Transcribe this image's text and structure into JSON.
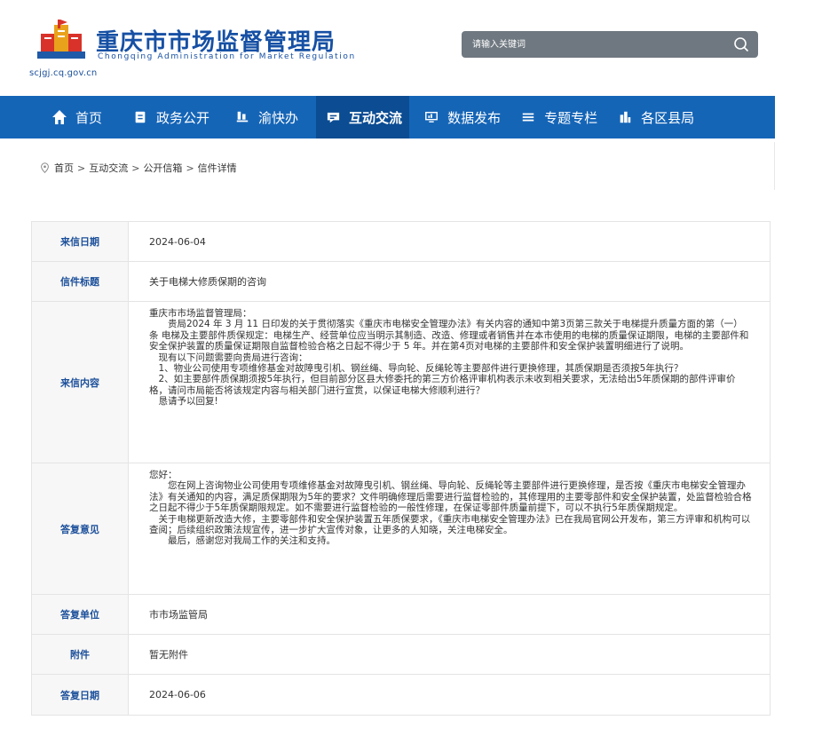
{
  "header": {
    "title": "重庆市市场监督管理局",
    "subtitle": "Chongqing  Administration for Market Regulation",
    "url": "scjgj.cq.gov.cn"
  },
  "search": {
    "placeholder": "请输入关键词",
    "icon": "search-icon"
  },
  "colors": {
    "nav_bg": "#1565b7",
    "nav_active": "#0b4c93",
    "brand": "#1650a4",
    "label_text": "#1b4f9a"
  },
  "nav": {
    "items": [
      {
        "label": "首页",
        "icon": "home-icon"
      },
      {
        "label": "政务公开",
        "icon": "document-icon"
      },
      {
        "label": "渝快办",
        "icon": "service-icon"
      },
      {
        "label": "互动交流",
        "icon": "chat-icon",
        "active": true
      },
      {
        "label": "数据发布",
        "icon": "monitor-icon"
      },
      {
        "label": "专题专栏",
        "icon": "list-icon"
      },
      {
        "label": "各区县局",
        "icon": "building-icon"
      }
    ]
  },
  "breadcrumb": {
    "items": [
      "首页",
      "互动交流",
      "公开信箱",
      "信件详情"
    ],
    "separator": ">"
  },
  "letter": {
    "date_label": "来信日期",
    "date": "2024-06-04",
    "title_label": "信件标题",
    "title": "关于电梯大修质保期的咨询",
    "content_label": "来信内容",
    "content": [
      "重庆市市场监督管理局：",
      "贵局2024 年 3 月 11 日印发的关于贯彻落实《重庆市电梯安全管理办法》有关内容的通知中第3页第三款关于电梯提升质量方面的第（一）条 电梯及主要部件质保规定：电梯生产、经营单位应当明示其制造、改造、修理或者销售并在本市使用的电梯的质量保证期限，电梯的主要部件和安全保护装置的质量保证期限自监督检验合格之日起不得少于 5 年。并在第4页对电梯的主要部件和安全保护装置明细进行了说明。",
      "现有以下问题需要向贵局进行咨询：",
      "1、物业公司使用专项维修基金对故障曳引机、钢丝绳、导向轮、反绳轮等主要部件进行更换修理，其质保期是否须按5年执行？",
      "2、如主要部件质保期须按5年执行，但目前部分区县大修委托的第三方价格评审机构表示未收到相关要求，无法给出5年质保期的部件评审价格，请问市局能否将该规定内容与相关部门进行宣贯，以保证电梯大修顺利进行？",
      "恳请予以回复!"
    ],
    "reply_label": "答复意见",
    "reply": [
      "您好：",
      "您在网上咨询物业公司使用专项维修基金对故障曳引机、钢丝绳、导向轮、反绳轮等主要部件进行更换修理，是否按《重庆市电梯安全管理办法》有关通知的内容，满足质保期限为5年的要求？文件明确修理后需要进行监督检验的，其修理用的主要零部件和安全保护装置，处监督检验合格之日起不得少于5年质保期限规定。如不需要进行监督检验的一般性修理，在保证零部件质量前提下，可以不执行5年质保期规定。",
      "关于电梯更新改造大修，主要零部件和安全保护装置五年质保要求，《重庆市电梯安全管理办法》已在我局官网公开发布，第三方评审和机构可以查阅；后续组织政策法规宣传，进一步扩大宣传对象，让更多的人知晓，关注电梯安全。",
      "最后，感谢您对我局工作的关注和支持。"
    ],
    "unit_label": "答复单位",
    "unit": "市市场监管局",
    "attachment_label": "附件",
    "attachment": "暂无附件",
    "reply_date_label": "答复日期",
    "reply_date": "2024-06-06"
  }
}
